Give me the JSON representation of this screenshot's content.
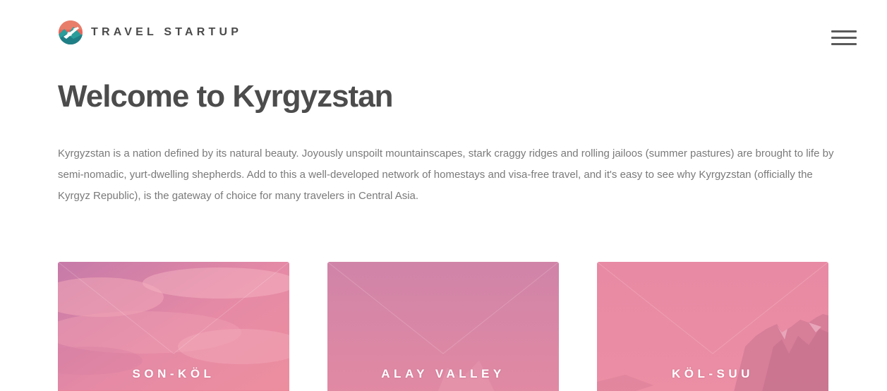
{
  "header": {
    "brand": "TRAVEL STARTUP",
    "logo_icon": "airplane-globe-icon",
    "menu_icon": "hamburger-menu-icon"
  },
  "main": {
    "title": "Welcome to Kyrgyzstan",
    "intro": "Kyrgyzstan is a nation defined by its natural beauty. Joyously unspoilt mountainscapes, stark craggy ridges and rolling jailoos (summer pastures) are brought to life by semi-nomadic, yurt-dwelling shepherds. Add to this a well-developed network of homestays and visa-free travel, and it's easy to see why Kyrgyzstan (officially the Kyrgyz Republic), is the gateway of choice for many travelers in Central Asia."
  },
  "cards": [
    {
      "label": "SON-KÖL",
      "scene": "pink-clouds"
    },
    {
      "label": "ALAY VALLEY",
      "scene": "pink-haze"
    },
    {
      "label": "KÖL-SUU",
      "scene": "pink-mountains"
    }
  ],
  "colors": {
    "heading": "#4c4c4c",
    "body_text": "#7a7a7a",
    "card_overlay": "#e8829f",
    "logo_teal": "#2a9d9b",
    "logo_coral": "#e8655a"
  }
}
